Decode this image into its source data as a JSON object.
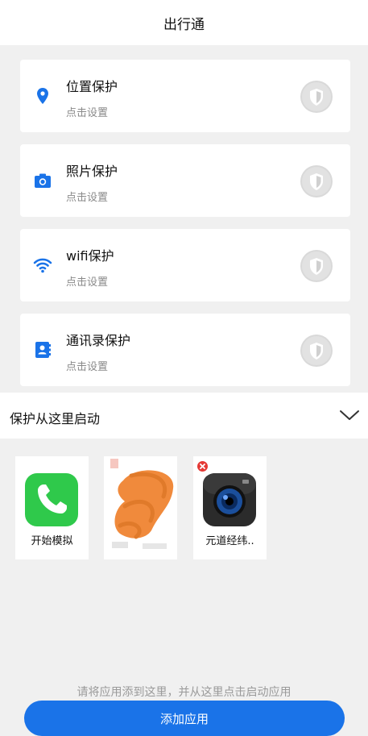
{
  "header": {
    "title": "出行通"
  },
  "cards": [
    {
      "title": "位置保护",
      "subtitle": "点击设置",
      "icon": "location-pin-icon"
    },
    {
      "title": "照片保护",
      "subtitle": "点击设置",
      "icon": "camera-icon"
    },
    {
      "title": "wifi保护",
      "subtitle": "点击设置",
      "icon": "wifi-icon"
    },
    {
      "title": "通讯录保护",
      "subtitle": "点击设置",
      "icon": "contacts-icon"
    }
  ],
  "section": {
    "title": "保护从这里启动",
    "icon": "chevron-down-icon"
  },
  "apps": [
    {
      "label": "开始模拟",
      "icon": "phone-app-icon"
    },
    {
      "label": "",
      "icon": "redacted-app-icon"
    },
    {
      "label": "元道经纬..",
      "icon": "camera-app-icon"
    }
  ],
  "hint": "请将应用添到这里，并从这里点击启动应用",
  "add_button": {
    "label": "添加应用"
  },
  "colors": {
    "accent": "#1a73e8",
    "background": "#f0f0f0",
    "card": "#ffffff",
    "remove_badge": "#e53935",
    "redaction": "#f08a3c"
  }
}
